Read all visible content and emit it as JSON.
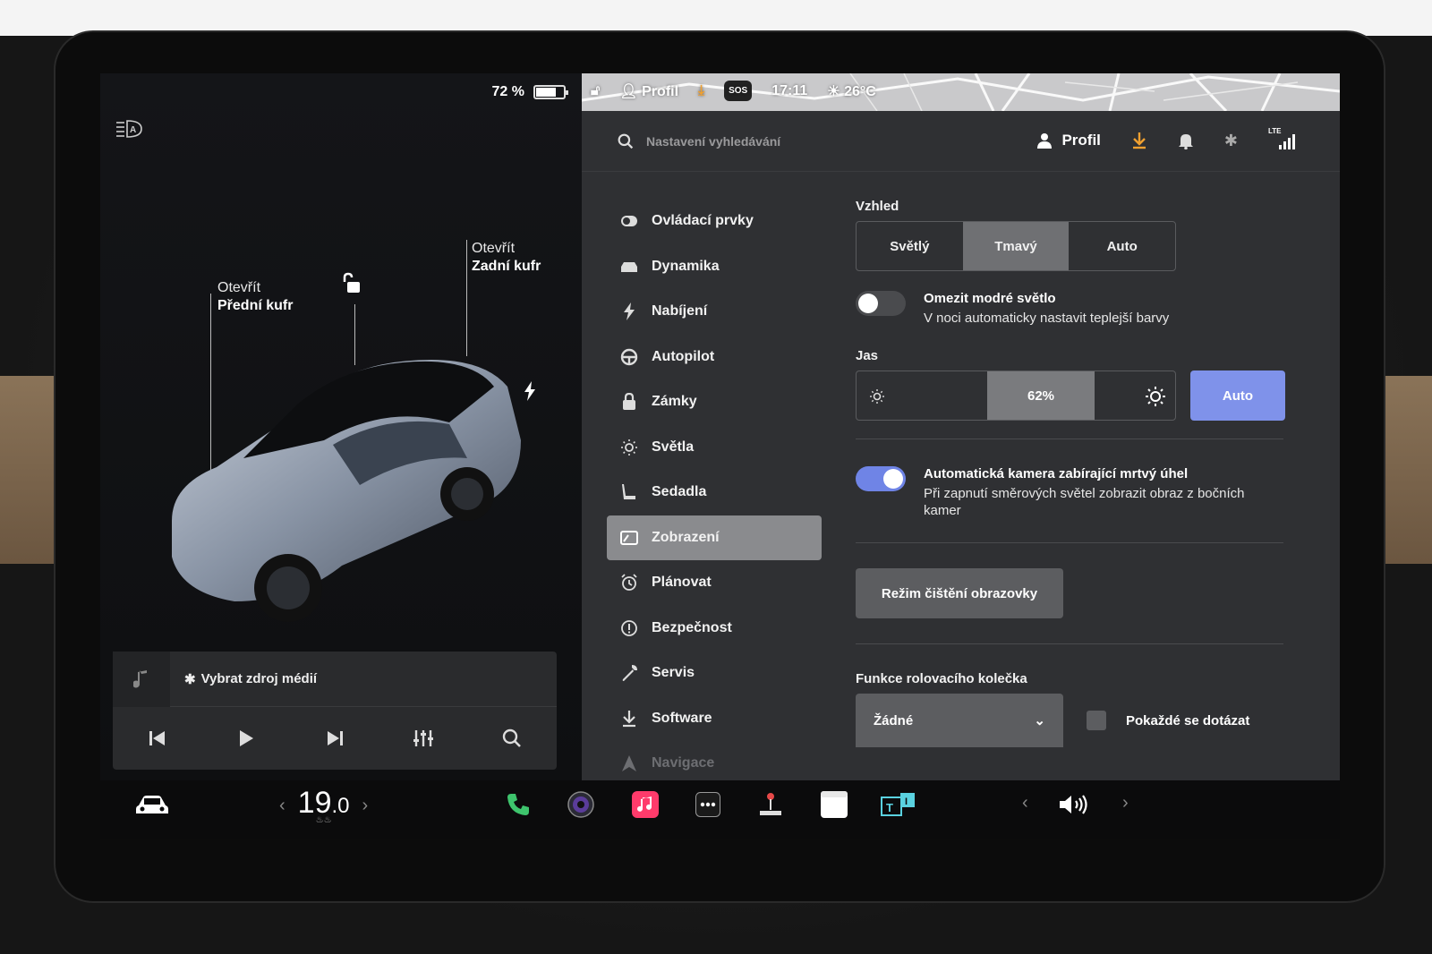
{
  "status": {
    "battery_percent": "72 %",
    "battery_level": 0.72,
    "profile": "Profil",
    "sos": "SOS",
    "time": "17:11",
    "temperature": "26°C"
  },
  "car_view": {
    "front_trunk": {
      "line1": "Otevřít",
      "line2": "Přední kufr"
    },
    "rear_trunk": {
      "line1": "Otevřít",
      "line2": "Zadní kufr"
    }
  },
  "media": {
    "source_label": "Vybrat zdroj médií"
  },
  "search": {
    "placeholder": "Nastavení vyhledávání"
  },
  "header": {
    "profile_label": "Profil",
    "signal_label": "LTE"
  },
  "menu": {
    "items": [
      {
        "label": "Ovládací prvky",
        "icon": "toggle-icon"
      },
      {
        "label": "Dynamika",
        "icon": "car-icon"
      },
      {
        "label": "Nabíjení",
        "icon": "bolt-icon"
      },
      {
        "label": "Autopilot",
        "icon": "steering-wheel-icon"
      },
      {
        "label": "Zámky",
        "icon": "lock-icon"
      },
      {
        "label": "Světla",
        "icon": "sun-icon"
      },
      {
        "label": "Sedadla",
        "icon": "seat-icon"
      },
      {
        "label": "Zobrazení",
        "icon": "display-icon"
      },
      {
        "label": "Plánovat",
        "icon": "alarm-clock-icon"
      },
      {
        "label": "Bezpečnost",
        "icon": "alert-circle-icon"
      },
      {
        "label": "Servis",
        "icon": "wrench-icon"
      },
      {
        "label": "Software",
        "icon": "download-icon"
      },
      {
        "label": "Navigace",
        "icon": "navigation-icon"
      }
    ],
    "active_index": 7
  },
  "display": {
    "appearance": {
      "title": "Vzhled",
      "options": [
        "Světlý",
        "Tmavý",
        "Auto"
      ],
      "selected": "Tmavý"
    },
    "blue_light": {
      "title": "Omezit modré světlo",
      "description": "V noci automaticky nastavit teplejší barvy",
      "enabled": false
    },
    "brightness": {
      "title": "Jas",
      "value_label": "62%",
      "value": 0.62,
      "auto_label": "Auto"
    },
    "blind_spot": {
      "title": "Automatická kamera zabírající mrtvý úhel",
      "description": "Při zapnutí směrových světel zobrazit obraz z bočních kamer",
      "enabled": true
    },
    "clean_mode_label": "Režim čištění obrazovky",
    "scroll_wheel": {
      "title": "Funkce rolovacího kolečka",
      "selected": "Žádné",
      "ask_label": "Pokaždé se dotázat"
    }
  },
  "dock": {
    "temperature_whole": "19",
    "temperature_decimal": ".0"
  },
  "colors": {
    "accent_blue": "#7f92ea",
    "toggle_on": "#6f84e6",
    "download_orange": "#f0a030",
    "phone_green": "#3ec46d",
    "music_pink": "#ff3b6b"
  }
}
